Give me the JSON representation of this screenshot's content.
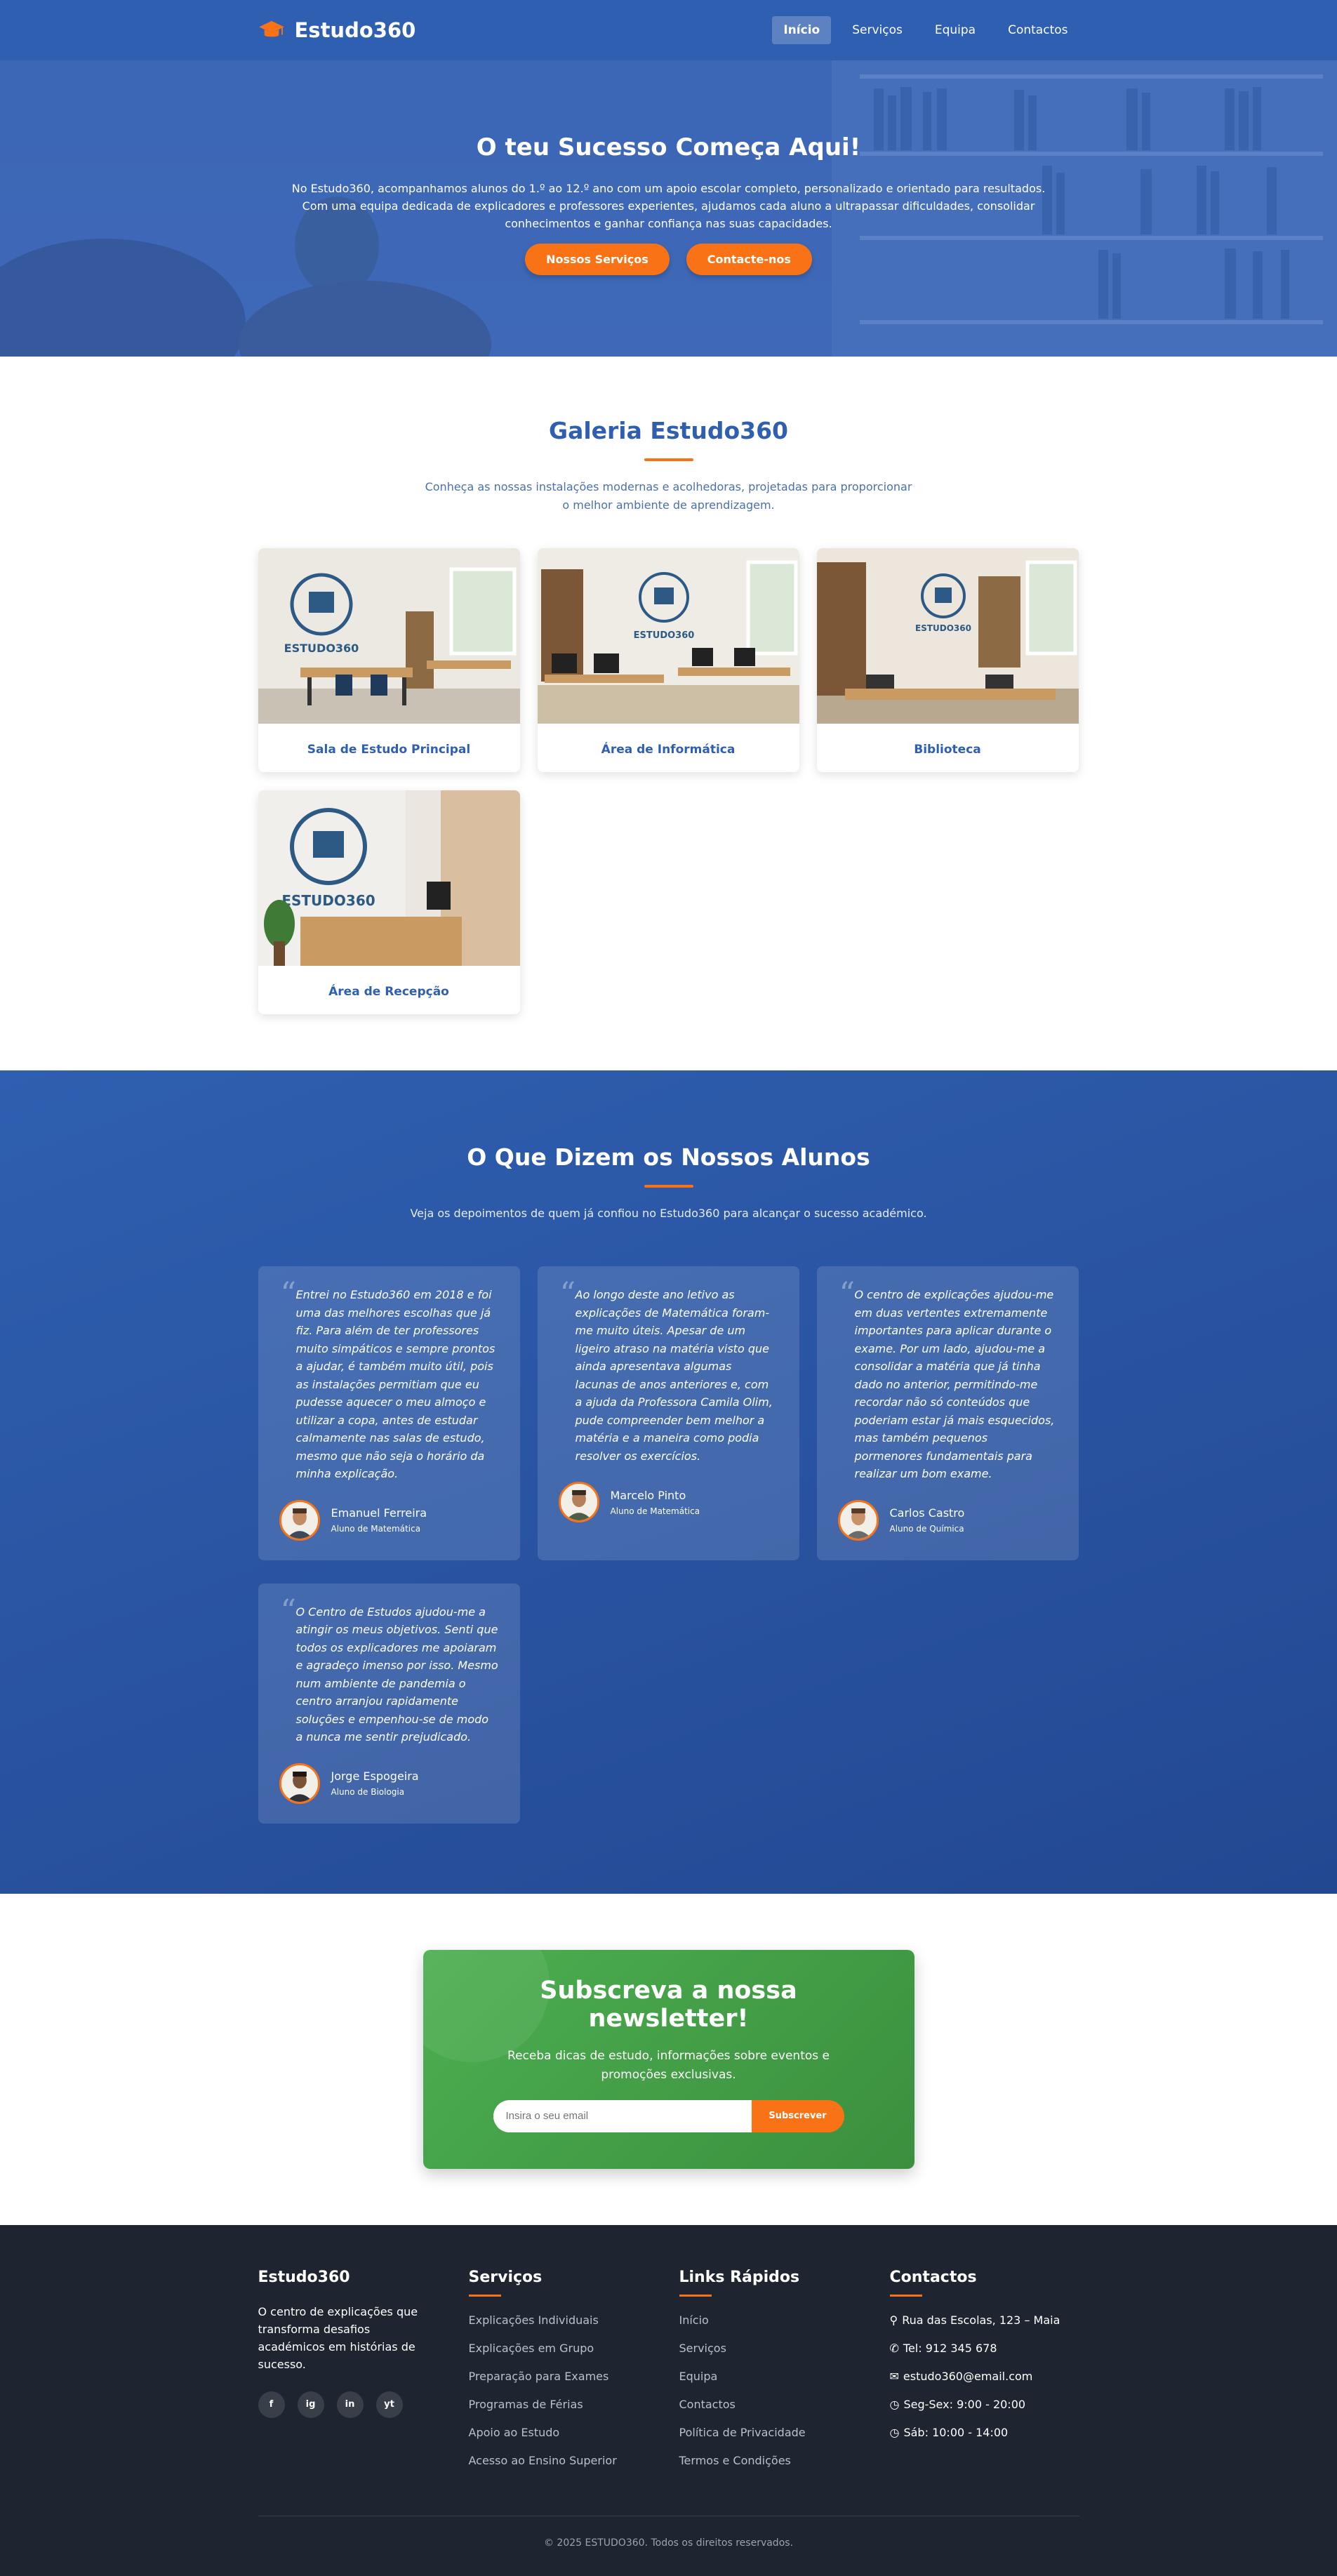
{
  "nav": {
    "brand": "Estudo360",
    "links": [
      "Início",
      "Serviços",
      "Equipa",
      "Contactos"
    ]
  },
  "hero": {
    "title": "O teu Sucesso Começa Aqui!",
    "line1": "No Estudo360, acompanhamos alunos do 1.º ao 12.º ano com um apoio escolar completo, personalizado e orientado para resultados.",
    "line2": "Com uma equipa dedicada de explicadores e professores experientes, ajudamos cada aluno a ultrapassar dificuldades, consolidar conhecimentos e ganhar confiança nas suas capacidades.",
    "btn_services": "Nossos Serviços",
    "btn_contact": "Contacte-nos"
  },
  "gallery": {
    "title": "Galeria Estudo360",
    "subtitle": "Conheça as nossas instalações modernas e acolhedoras, projetadas para proporcionar o melhor ambiente de aprendizagem.",
    "items": [
      {
        "caption": "Sala de Estudo Principal",
        "logo_text": "ESTUDO360"
      },
      {
        "caption": "Área de Informática",
        "logo_text": "ESTUDO360"
      },
      {
        "caption": "Biblioteca",
        "logo_text": "ESTUDO360"
      },
      {
        "caption": "Área de Recepção",
        "logo_text": "ESTUDO360"
      }
    ]
  },
  "testimonials": {
    "title": "O Que Dizem os Nossos Alunos",
    "subtitle": "Veja os depoimentos de quem já confiou no Estudo360 para alcançar o sucesso académico.",
    "items": [
      {
        "text": "Entrei no Estudo360 em 2018 e foi uma das melhores escolhas que já fiz. Para além de ter professores muito simpáticos e sempre prontos a ajudar, é também muito útil, pois as instalações permitiam que eu pudesse aquecer o meu almoço e utilizar a copa, antes de estudar calmamente nas salas de estudo, mesmo que não seja o horário da minha explicação.",
        "name": "Emanuel Ferreira",
        "role": "Aluno de Matemática"
      },
      {
        "text": "Ao longo deste ano letivo as explicações de Matemática foram-me muito úteis. Apesar de um ligeiro atraso na matéria visto que ainda apresentava algumas lacunas de anos anteriores e, com a ajuda da Professora Camila Olim, pude compreender bem melhor a matéria e a maneira como podia resolver os exercícios.",
        "name": "Marcelo Pinto",
        "role": "Aluno de Matemática"
      },
      {
        "text": "O centro de explicações ajudou-me em duas vertentes extremamente importantes para aplicar durante o exame. Por um lado, ajudou-me a consolidar a matéria que já tinha dado no anterior, permitindo-me recordar não só conteúdos que poderiam estar já mais esquecidos, mas também pequenos pormenores fundamentais para realizar um bom exame.",
        "name": "Carlos Castro",
        "role": "Aluno de Química"
      },
      {
        "text": "O Centro de Estudos ajudou-me a atingir os meus objetivos. Senti que todos os explicadores me apoiaram e agradeço imenso por isso. Mesmo num ambiente de pandemia o centro arranjou rapidamente soluções e empenhou-se de modo a nunca me sentir prejudicado.",
        "name": "Jorge Espogeira",
        "role": "Aluno de Biologia"
      }
    ]
  },
  "newsletter": {
    "title": "Subscreva a nossa newsletter!",
    "text": "Receba dicas de estudo, informações sobre eventos e promoções exclusivas.",
    "placeholder": "Insira o seu email",
    "button": "Subscrever"
  },
  "footer": {
    "about_title": "Estudo360",
    "about_text": "O centro de explicações que transforma desafios académicos em histórias de sucesso.",
    "social": [
      "f",
      "ig",
      "in",
      "yt"
    ],
    "services_title": "Serviços",
    "services": [
      "Explicações Individuais",
      "Explicações em Grupo",
      "Preparação para Exames",
      "Programas de Férias",
      "Apoio ao Estudo",
      "Acesso ao Ensino Superior"
    ],
    "links_title": "Links Rápidos",
    "links": [
      "Início",
      "Serviços",
      "Equipa",
      "Contactos",
      "Política de Privacidade",
      "Termos e Condições"
    ],
    "contacts_title": "Contactos",
    "contacts": [
      {
        "icon": "map-marker-icon",
        "text": "Rua das Escolas, 123 – Maia"
      },
      {
        "icon": "phone-icon",
        "text": "Tel: 912 345 678"
      },
      {
        "icon": "envelope-icon",
        "text": "estudo360@email.com"
      },
      {
        "icon": "clock-icon",
        "text": "Seg-Sex: 9:00 - 20:00"
      },
      {
        "icon": "clock-icon",
        "text": "Sáb: 10:00 - 14:00"
      }
    ],
    "copyright": "© 2025 ESTUDO360. Todos os direitos reservados."
  },
  "colors": {
    "primary": "#2f5fb0",
    "accent": "#f97316",
    "green": "#4caf50",
    "footer": "#1e2530"
  }
}
